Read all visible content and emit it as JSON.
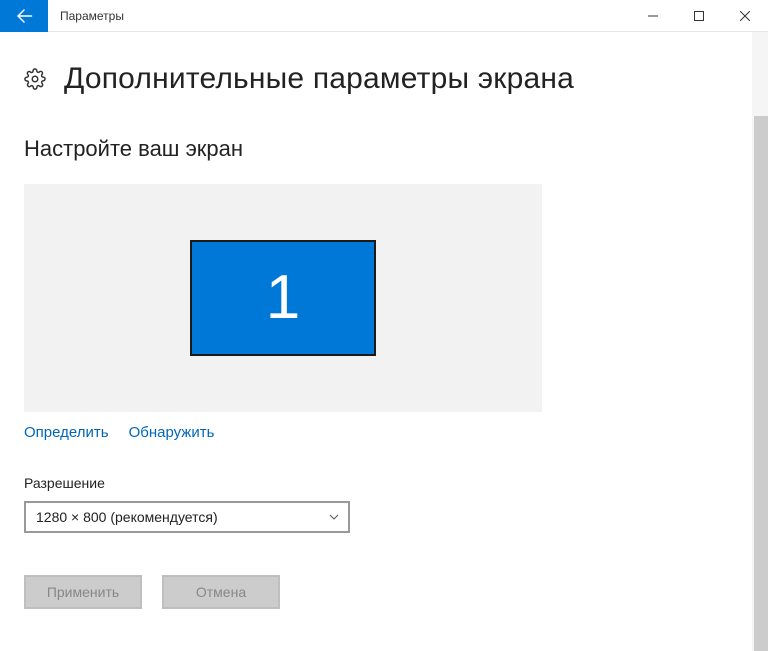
{
  "titlebar": {
    "title": "Параметры"
  },
  "page": {
    "title": "Дополнительные параметры экрана",
    "section_title": "Настройте ваш экран"
  },
  "displays": {
    "monitor_1": "1",
    "identify_link": "Определить",
    "detect_link": "Обнаружить"
  },
  "resolution": {
    "label": "Разрешение",
    "selected": "1280 × 800 (рекомендуется)"
  },
  "buttons": {
    "apply": "Применить",
    "cancel": "Отмена"
  }
}
